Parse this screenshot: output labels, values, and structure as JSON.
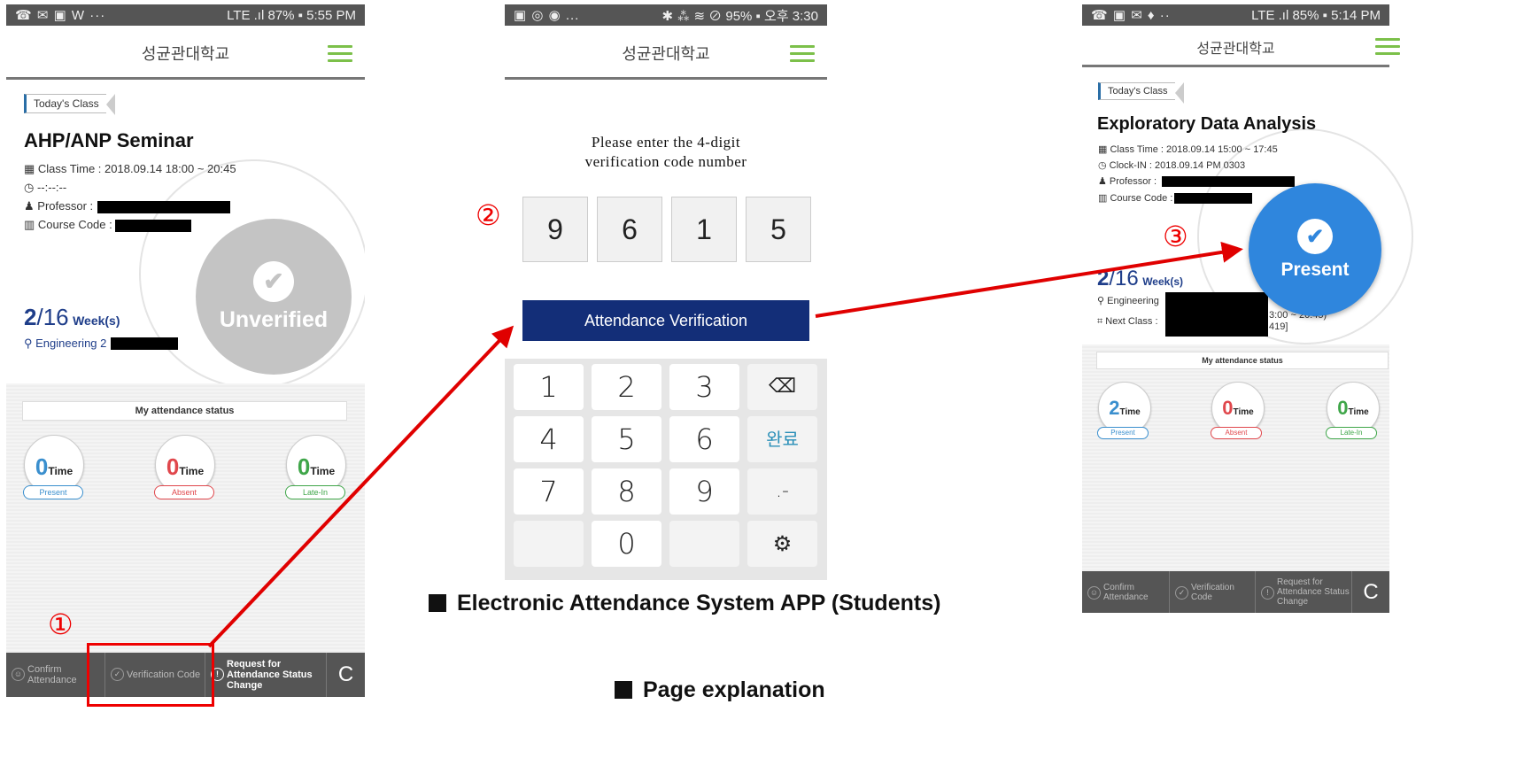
{
  "phone1": {
    "status_left": "☎ ✉ ▣ W ···",
    "status_right": "LTE .ıl 87% ▪ 5:55 PM",
    "app_title": "성균관대학교",
    "tag": "Today's Class",
    "course_title": "AHP/ANP Seminar",
    "class_time": "Class Time : 2018.09.14 18:00 ~ 20:45",
    "clock_in": "--:--:--",
    "professor_label": "Professor :",
    "course_code_label": "Course Code :",
    "week_current": "2",
    "week_total": "/16",
    "week_suffix": "Week(s)",
    "location": "Engineering 2",
    "stamp_text": "Unverified",
    "status_label": "My attendance status",
    "stats": [
      {
        "count": "0",
        "unit": "Time",
        "label": "Present",
        "color": "#3a8fce"
      },
      {
        "count": "0",
        "unit": "Time",
        "label": "Absent",
        "color": "#e0474c"
      },
      {
        "count": "0",
        "unit": "Time",
        "label": "Late-In",
        "color": "#3fa649"
      }
    ],
    "bottom": [
      {
        "label": "Confirm Attendance"
      },
      {
        "label": "Verification Code"
      },
      {
        "label": "Request for Attendance Status Change"
      }
    ],
    "refresh": "C"
  },
  "phone2": {
    "status_left": "▣ ◎ ◉ ...",
    "status_right": "✱ ⁂ ≋ ⊘ 95% ▪ 오후 3:30",
    "app_title": "성균관대학교",
    "prompt_line1": "Please enter the 4-digit",
    "prompt_line2": "verification code number",
    "digits": [
      "9",
      "6",
      "1",
      "5"
    ],
    "verify_button": "Attendance Verification",
    "keys": [
      "1",
      "2",
      "3",
      "⌫",
      "4",
      "5",
      "6",
      "완료",
      "7",
      "8",
      "9",
      ".-",
      "",
      "0",
      "",
      "⚙"
    ]
  },
  "phone3": {
    "status_left": "☎ ▣ ✉ ♦ ··",
    "status_right": "LTE .ıl 85% ▪ 5:14 PM",
    "app_title": "성균관대학교",
    "tag": "Today's Class",
    "course_title": "Exploratory Data Analysis",
    "class_time": "Class Time : 2018.09.14 15:00 ~ 17:45",
    "clock_in": "Clock-IN : 2018.09.14 PM 0303",
    "professor_label": "Professor :",
    "course_code_label": "Course Code :",
    "week_current": "2",
    "week_total": "/16",
    "week_suffix": "Week(s)",
    "location": "Engineering",
    "next_class_label": "Next Class :",
    "next_class_time": "3:00 ~ 20:45)",
    "next_class_room": "419]",
    "stamp_text": "Present",
    "status_label": "My attendance status",
    "stats": [
      {
        "count": "2",
        "unit": "Time",
        "label": "Present",
        "color": "#3a8fce"
      },
      {
        "count": "0",
        "unit": "Time",
        "label": "Absent",
        "color": "#e0474c"
      },
      {
        "count": "0",
        "unit": "Time",
        "label": "Late-In",
        "color": "#3fa649"
      }
    ],
    "bottom": [
      {
        "label": "Confirm Attendance"
      },
      {
        "label": "Verification Code"
      },
      {
        "label": "Request for Attendance Status Change"
      }
    ],
    "refresh": "C"
  },
  "annotations": {
    "step1": "①",
    "step2": "②",
    "step3": "③",
    "caption_app": "Electronic Attendance System APP (Students)",
    "caption_page": "Page explanation"
  },
  "colors": {
    "accent_blue": "#132e78",
    "highlight_red": "#e00000",
    "present_blue": "#2f86dd",
    "menu_green": "#7cc04a"
  }
}
